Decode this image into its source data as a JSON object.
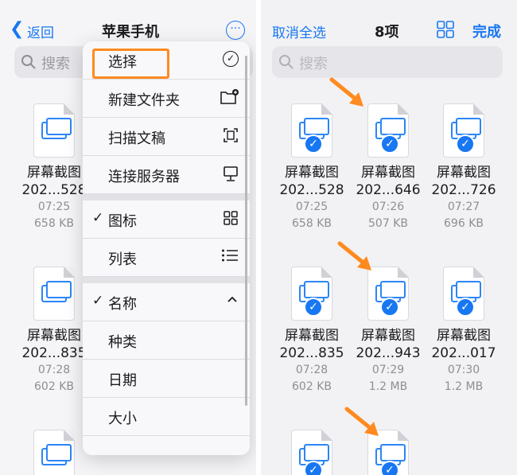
{
  "left": {
    "back_label": "返回",
    "title": "苹果手机",
    "search_placeholder": "搜索",
    "files": [
      {
        "name": "屏幕截图",
        "short": "202...528",
        "time": "07:25",
        "size": "658 KB"
      },
      {
        "name": "屏幕截图",
        "short": "202...835",
        "time": "07:28",
        "size": "602 KB"
      }
    ],
    "menu": [
      {
        "label": "选择",
        "icon": "checkmark-circle-icon"
      },
      {
        "label": "新建文件夹",
        "icon": "new-folder-icon"
      },
      {
        "label": "扫描文稿",
        "icon": "scan-document-icon"
      },
      {
        "label": "连接服务器",
        "icon": "connect-server-icon"
      },
      {
        "label": "图标",
        "icon": "grid-view-icon",
        "checked": true
      },
      {
        "label": "列表",
        "icon": "list-view-icon"
      },
      {
        "label": "名称",
        "icon": "chevron-up-icon",
        "checked": true
      },
      {
        "label": "种类"
      },
      {
        "label": "日期"
      },
      {
        "label": "大小"
      }
    ]
  },
  "right": {
    "cancel_all": "取消全选",
    "count": "8项",
    "done": "完成",
    "search_placeholder": "搜索",
    "files": [
      {
        "name": "屏幕截图",
        "short": "202...528",
        "time": "07:25",
        "size": "658 KB"
      },
      {
        "name": "屏幕截图",
        "short": "202...646",
        "time": "07:26",
        "size": "507 KB"
      },
      {
        "name": "屏幕截图",
        "short": "202...726",
        "time": "07:27",
        "size": "696 KB"
      },
      {
        "name": "屏幕截图",
        "short": "202...835",
        "time": "07:28",
        "size": "602 KB"
      },
      {
        "name": "屏幕截图",
        "short": "202...943",
        "time": "07:29",
        "size": "1.2 MB"
      },
      {
        "name": "屏幕截图",
        "short": "202...017",
        "time": "07:30",
        "size": "1.2 MB"
      }
    ]
  },
  "colors": {
    "accent": "#1877f2",
    "highlight": "#ff8a1f"
  }
}
